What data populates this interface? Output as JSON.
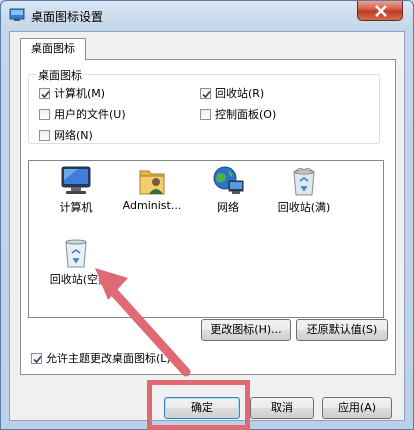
{
  "window": {
    "title": "桌面图标设置"
  },
  "tabs": [
    {
      "label": "桌面图标"
    }
  ],
  "desktop_icons": {
    "group_label": "桌面图标",
    "checkboxes": [
      {
        "label": "计算机(M)",
        "checked": true
      },
      {
        "label": "回收站(R)",
        "checked": true
      },
      {
        "label": "用户的文件(U)",
        "checked": false
      },
      {
        "label": "控制面板(O)",
        "checked": false
      },
      {
        "label": "网络(N)",
        "checked": false
      }
    ],
    "icons": [
      {
        "label": "计算机",
        "icon": "computer-icon"
      },
      {
        "label": "Administ...",
        "icon": "user-folder-icon"
      },
      {
        "label": "网络",
        "icon": "network-icon"
      },
      {
        "label": "回收站(满)",
        "icon": "recycle-bin-full-icon"
      },
      {
        "label": "回收站(空)",
        "icon": "recycle-bin-empty-icon"
      }
    ],
    "change_icon_label": "更改图标(H)...",
    "restore_default_label": "还原默认值(S)"
  },
  "allow_theme": {
    "label": "允许主题更改桌面图标(L)",
    "checked": true
  },
  "buttons": {
    "ok": "确定",
    "cancel": "取消",
    "apply": "应用(A)"
  },
  "annotation": {
    "highlight_color": "#e06a74"
  }
}
